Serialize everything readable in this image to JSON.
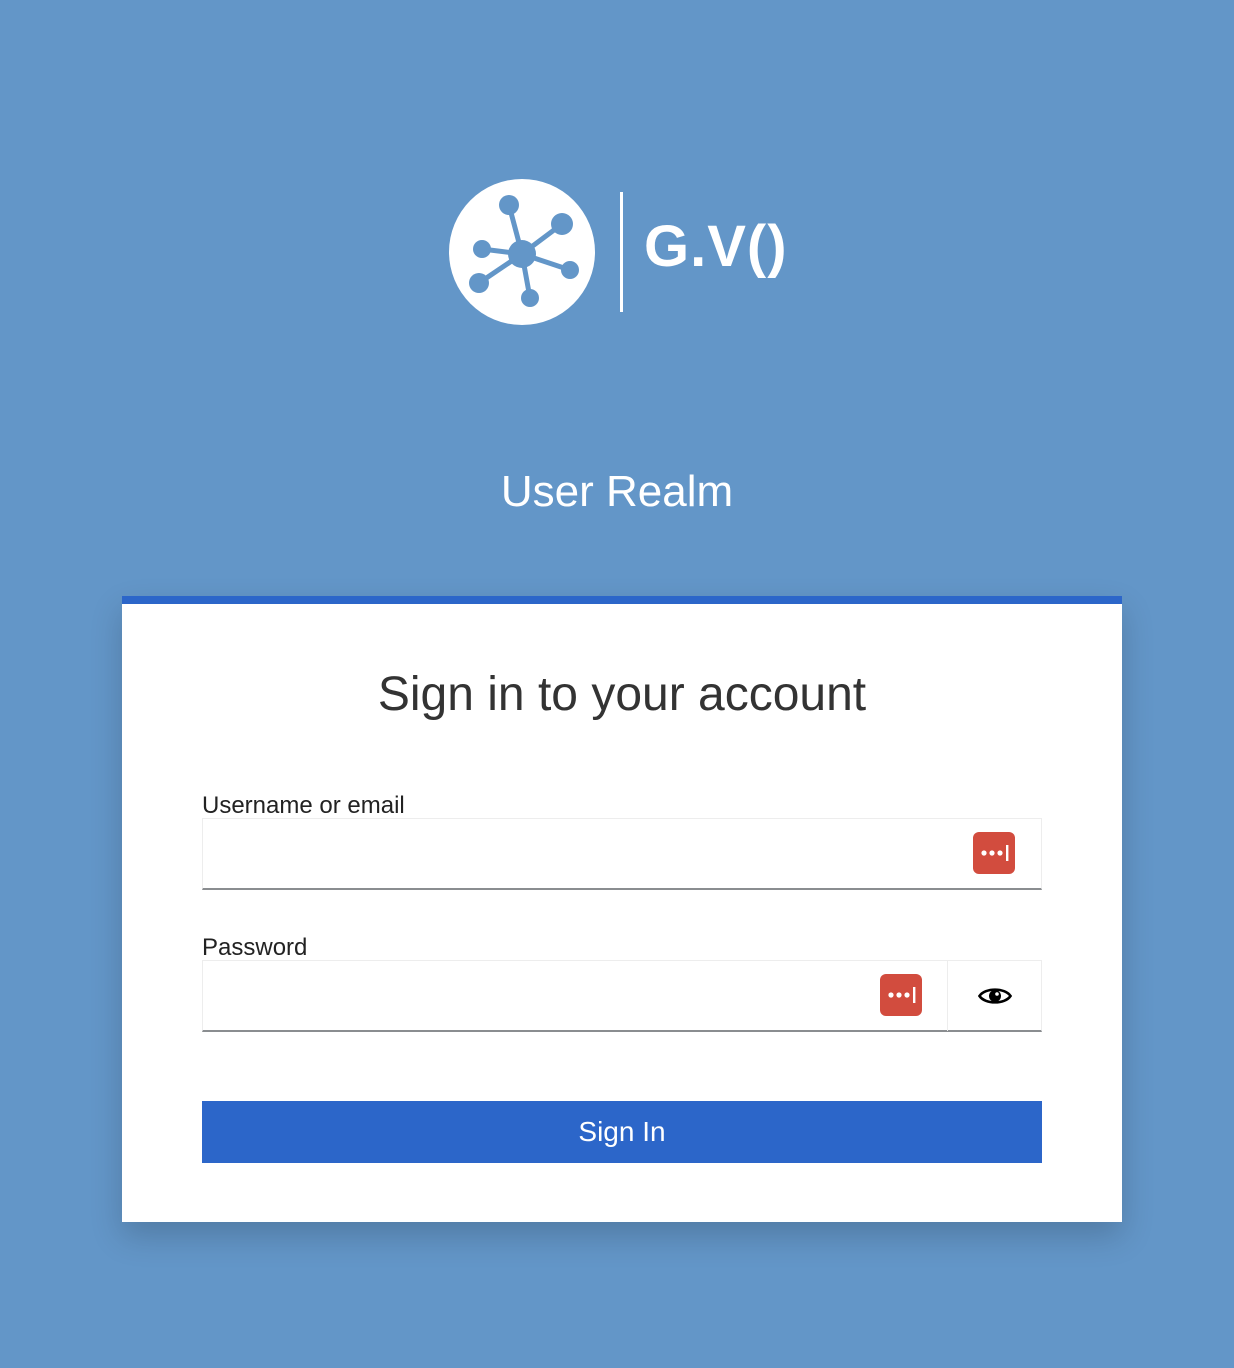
{
  "brand": {
    "logo_text": "G.V()",
    "logo_icon": "graph-network-icon",
    "background_color": "#6396c8",
    "accent_color": "#2c66c9"
  },
  "realm": {
    "title": "User Realm"
  },
  "login_form": {
    "title": "Sign in to your account",
    "username": {
      "label": "Username or email",
      "value": "",
      "placeholder": ""
    },
    "password": {
      "label": "Password",
      "value": "",
      "placeholder": ""
    },
    "password_manager_icon": "password-manager-icon",
    "show_password_icon": "eye-icon",
    "submit_label": "Sign In"
  }
}
